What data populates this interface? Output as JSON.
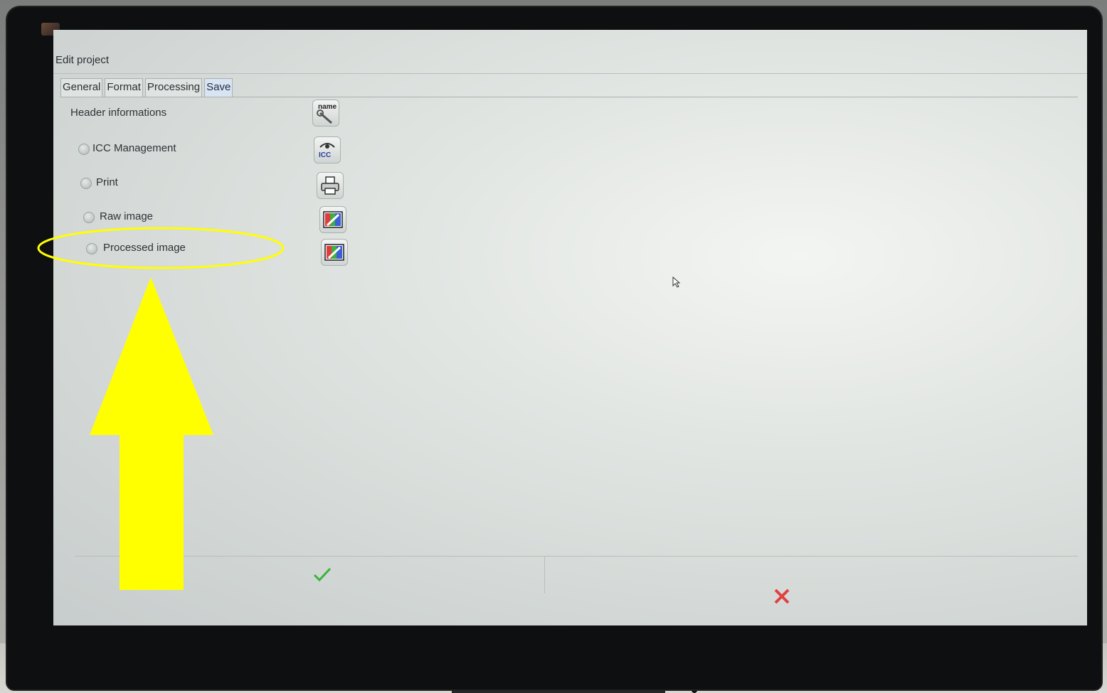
{
  "window": {
    "title": "Edit project"
  },
  "tabs": [
    {
      "label": "General",
      "active": false
    },
    {
      "label": "Format",
      "active": false
    },
    {
      "label": "Processing",
      "active": false
    },
    {
      "label": "Save",
      "active": true
    }
  ],
  "save_tab": {
    "section_header": "Header informations",
    "options": [
      {
        "label": "ICC Management",
        "icon": "icc-icon"
      },
      {
        "label": "Print",
        "icon": "printer-icon"
      },
      {
        "label": "Raw image",
        "icon": "image-icon"
      },
      {
        "label": "Processed image",
        "icon": "image-icon"
      }
    ],
    "header_icon_text": "name",
    "icc_icon_text": "ICC"
  },
  "buttons": {
    "ok": "checkmark-icon",
    "cancel": "x-icon"
  },
  "colors": {
    "annotation": "#ffff00",
    "ok": "#3bb33b",
    "cancel": "#e04040"
  }
}
